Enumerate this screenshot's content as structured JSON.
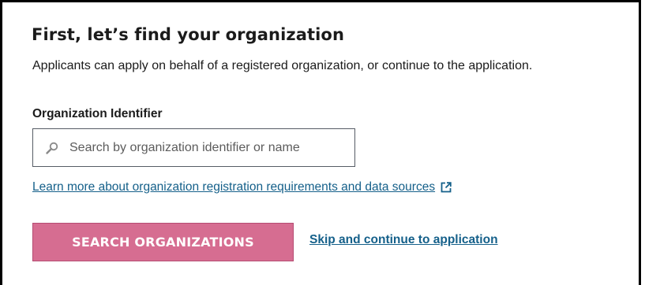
{
  "section": {
    "heading": "First, let’s find your organization",
    "description": "Applicants can apply on behalf of a registered organization, or continue to the application."
  },
  "organization_identifier": {
    "label": "Organization Identifier",
    "value": "",
    "placeholder": "Search by organization identifier or name"
  },
  "learn_more": {
    "text": "Learn more about organization registration requirements and data sources"
  },
  "actions": {
    "search_button_label": "SEARCH ORGANIZATIONS",
    "skip_link_label": "Skip and continue to application"
  },
  "icons": {
    "search": "search-icon",
    "external_link": "external-link-icon"
  },
  "colors": {
    "button_background": "#d66d91",
    "link": "#15608a",
    "text": "#1b1b1b"
  }
}
